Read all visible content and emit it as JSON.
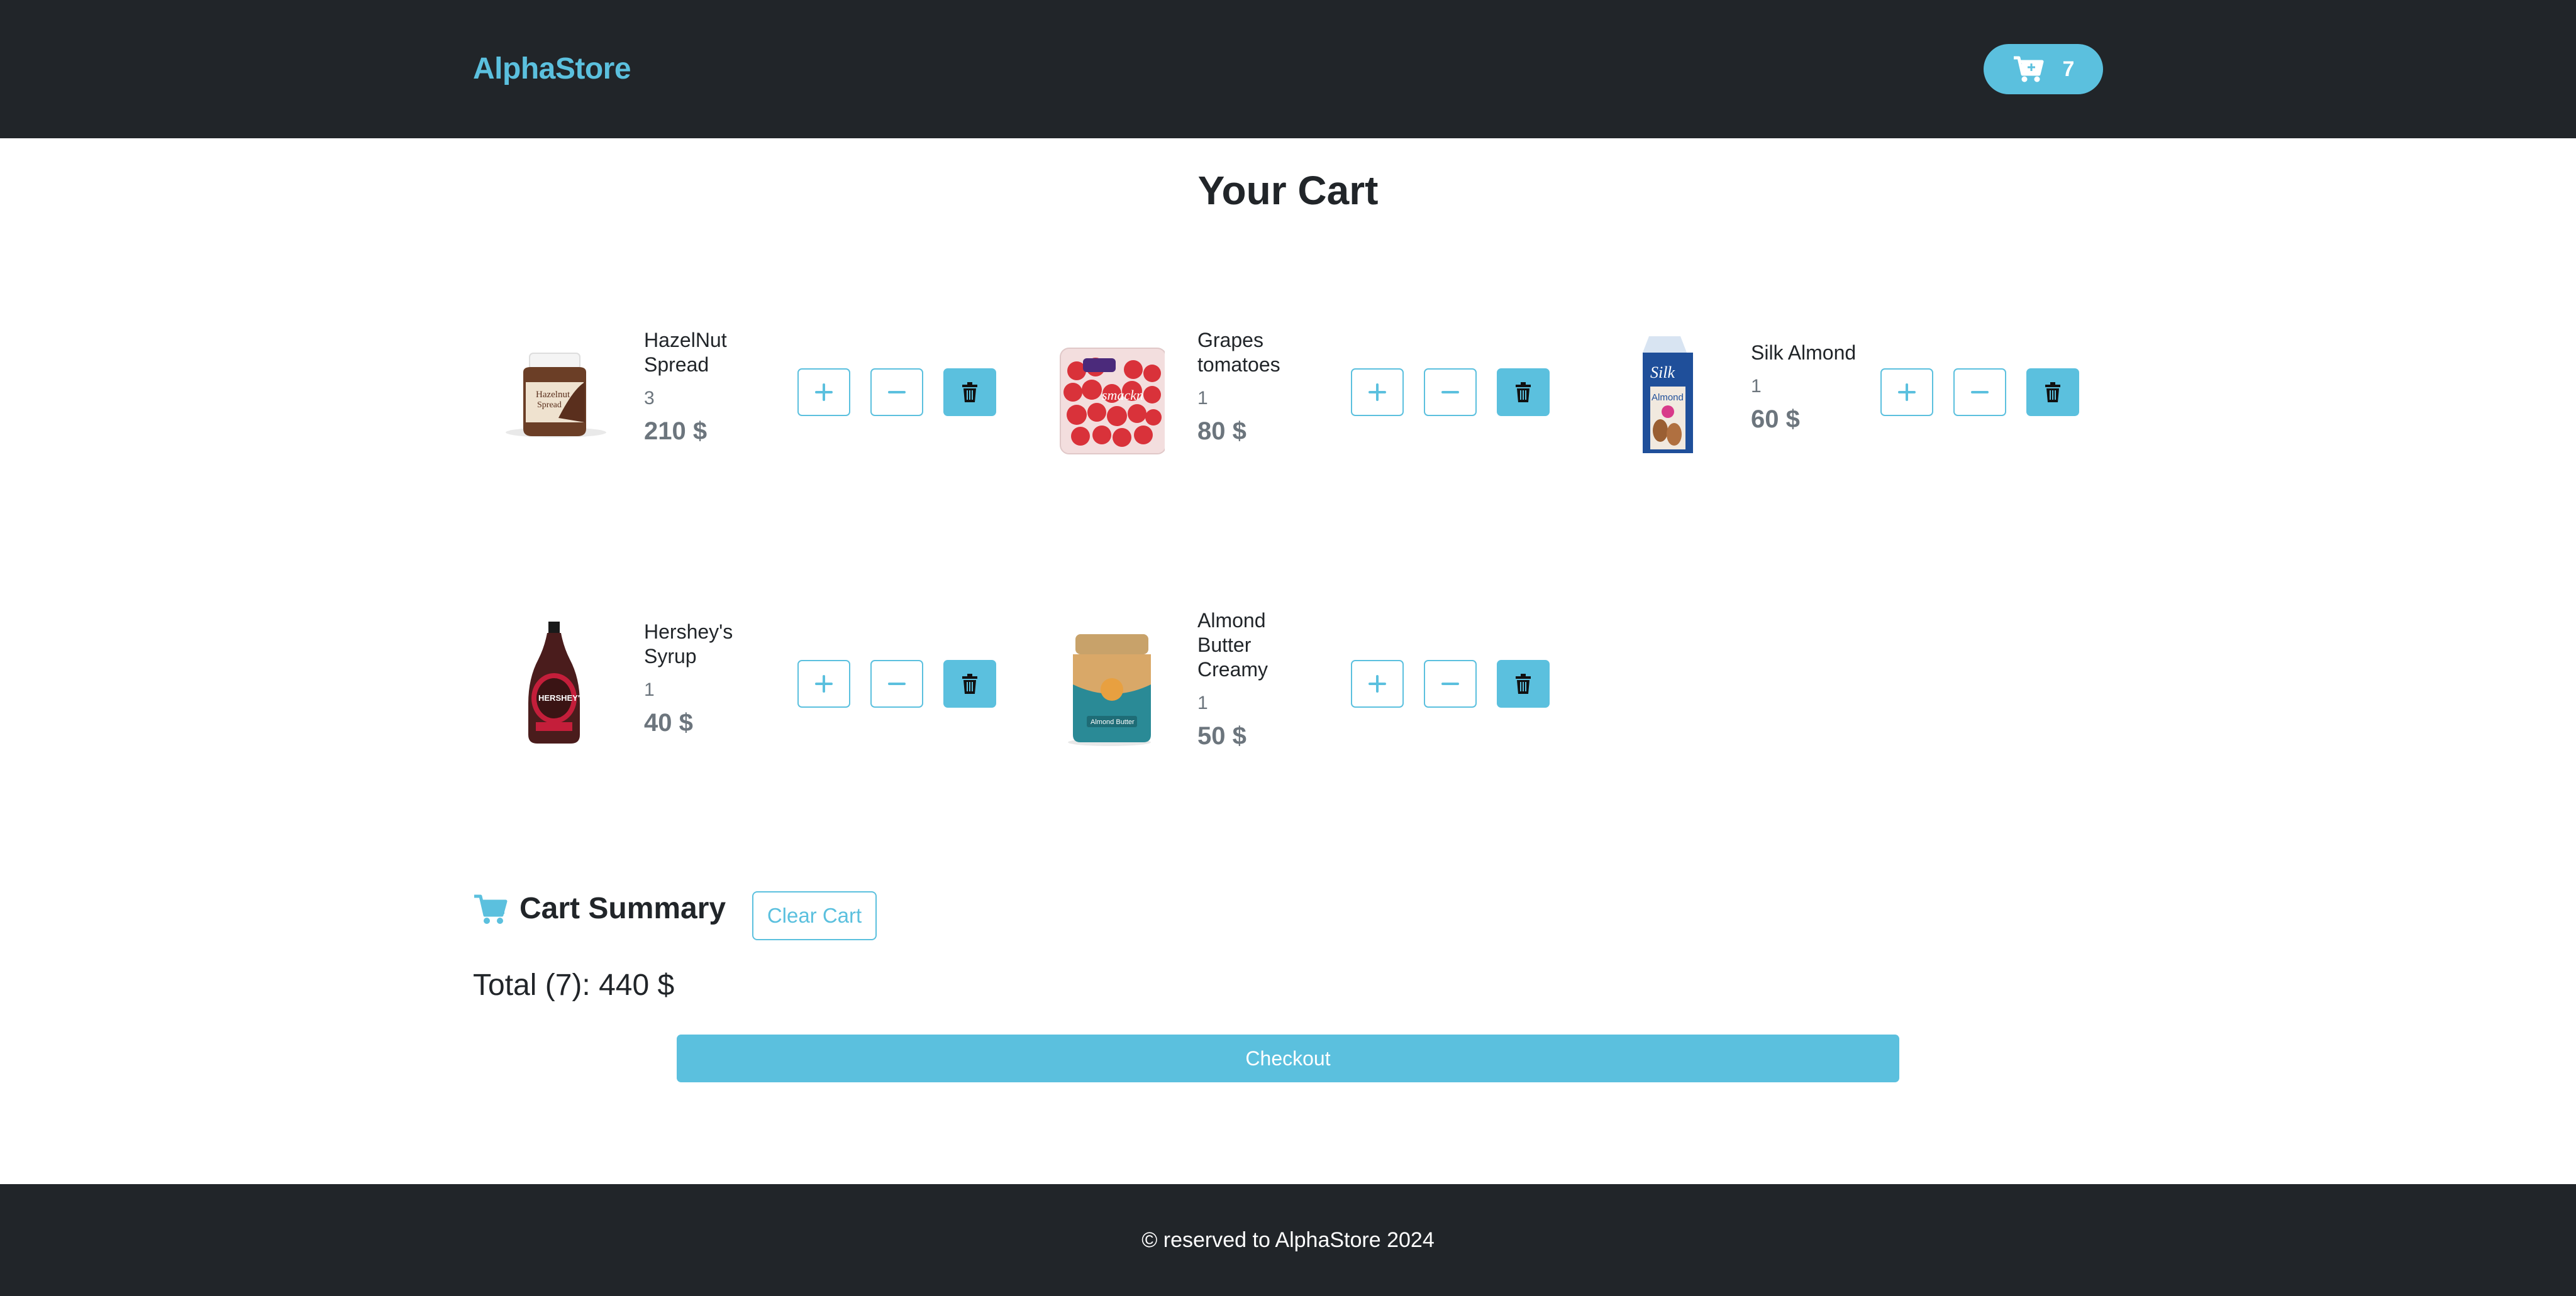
{
  "header": {
    "brand": "AlphaStore",
    "cart_count": "7",
    "cart_icon": "cart-icon"
  },
  "page": {
    "title": "Your Cart"
  },
  "items": [
    {
      "name": "HazelNut Spread",
      "qty": "3",
      "price": "210 $"
    },
    {
      "name": "Grapes tomatoes",
      "qty": "1",
      "price": "80 $"
    },
    {
      "name": "Silk Almond",
      "qty": "1",
      "price": "60 $"
    },
    {
      "name": "Hershey's Syrup",
      "qty": "1",
      "price": "40 $"
    },
    {
      "name": "Almond Butter Creamy",
      "qty": "1",
      "price": "50 $"
    }
  ],
  "summary": {
    "title": "Cart Summary",
    "clear_label": "Clear Cart",
    "total": "Total (7): 440 $",
    "checkout_label": "Checkout"
  },
  "footer": {
    "text": "© reserved to AlphaStore 2024"
  },
  "colors": {
    "accent": "#5bc0de",
    "dark": "#212529",
    "muted": "#6c757d"
  }
}
